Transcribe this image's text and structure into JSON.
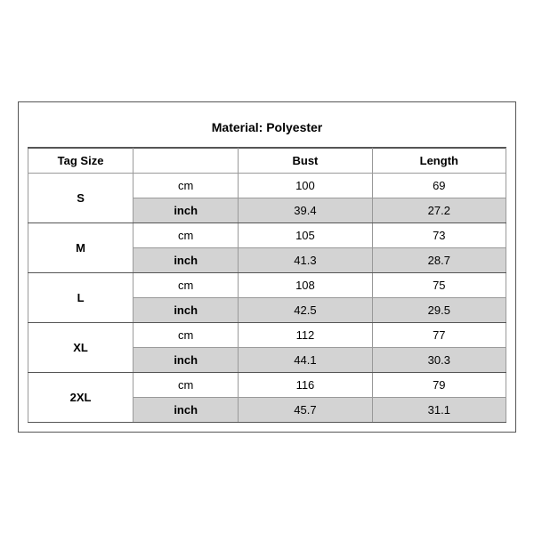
{
  "title": "Material: Polyester",
  "headers": {
    "tag_size": "Tag Size",
    "bust": "Bust",
    "length": "Length"
  },
  "sizes": [
    {
      "tag": "S",
      "rows": [
        {
          "unit": "cm",
          "bust": "100",
          "length": "69",
          "shaded": false
        },
        {
          "unit": "inch",
          "bust": "39.4",
          "length": "27.2",
          "shaded": true
        }
      ]
    },
    {
      "tag": "M",
      "rows": [
        {
          "unit": "cm",
          "bust": "105",
          "length": "73",
          "shaded": false
        },
        {
          "unit": "inch",
          "bust": "41.3",
          "length": "28.7",
          "shaded": true
        }
      ]
    },
    {
      "tag": "L",
      "rows": [
        {
          "unit": "cm",
          "bust": "108",
          "length": "75",
          "shaded": false
        },
        {
          "unit": "inch",
          "bust": "42.5",
          "length": "29.5",
          "shaded": true
        }
      ]
    },
    {
      "tag": "XL",
      "rows": [
        {
          "unit": "cm",
          "bust": "112",
          "length": "77",
          "shaded": false
        },
        {
          "unit": "inch",
          "bust": "44.1",
          "length": "30.3",
          "shaded": true
        }
      ]
    },
    {
      "tag": "2XL",
      "rows": [
        {
          "unit": "cm",
          "bust": "116",
          "length": "79",
          "shaded": false
        },
        {
          "unit": "inch",
          "bust": "45.7",
          "length": "31.1",
          "shaded": true
        }
      ]
    }
  ]
}
